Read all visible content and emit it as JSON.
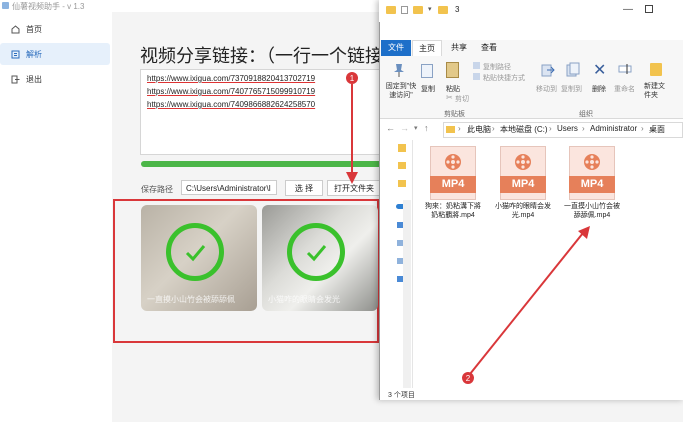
{
  "app": {
    "title": "仙薯视频助手 - v 1.3",
    "nav": [
      {
        "label": "首页"
      },
      {
        "label": "解析"
      },
      {
        "label": "退出"
      }
    ],
    "heading": "视频分享链接：（一行一个链接）",
    "links": [
      "https://www.ixigua.com/7370918820413702719",
      "https://www.ixigua.com/7407765715099910719",
      "https://www.ixigua.com/7409866882624258570"
    ],
    "progress_percent": 100,
    "save_label": "保存路径",
    "save_path": "C:\\Users\\Administrator\\I",
    "choose_label": "选 择",
    "open_folder_label": "打开文件夹",
    "results": [
      {
        "caption": "一直摸小山竹会被舔舔佩"
      },
      {
        "caption": "小猫咋的眼睛会发光"
      }
    ],
    "accent_color": "#4cb648",
    "highlight_color": "#d9373a"
  },
  "explorer": {
    "folder_name": "3",
    "tabs": [
      "文件",
      "主页",
      "共享",
      "查看"
    ],
    "ribbon": {
      "pin_label": "固定到\"快速访问\"",
      "copy_label": "复制",
      "paste_label": "粘贴",
      "copy_path_label": "复制路径",
      "paste_shortcut_label": "粘贴快捷方式",
      "cut_label": "剪切",
      "move_to_label": "移动到",
      "copy_to_label": "复制到",
      "delete_label": "删除",
      "rename_label": "重命名",
      "new_folder_label": "新建文件夹",
      "clipboard_group": "剪贴板",
      "organize_group": "组织"
    },
    "breadcrumb": [
      "此电脑",
      "本地磁盘 (C:)",
      "Users",
      "Administrator",
      "桌面"
    ],
    "files": [
      {
        "type": "MP4",
        "name": "狗來：奶粘溝下將奶粘覇將.mp4"
      },
      {
        "type": "MP4",
        "name": "小猫咋的眼睛会发光.mp4"
      },
      {
        "type": "MP4",
        "name": "一直摸小山竹会被舔舔佩.mp4"
      }
    ],
    "status": "3 个项目"
  },
  "annotations": [
    "1",
    "2"
  ]
}
